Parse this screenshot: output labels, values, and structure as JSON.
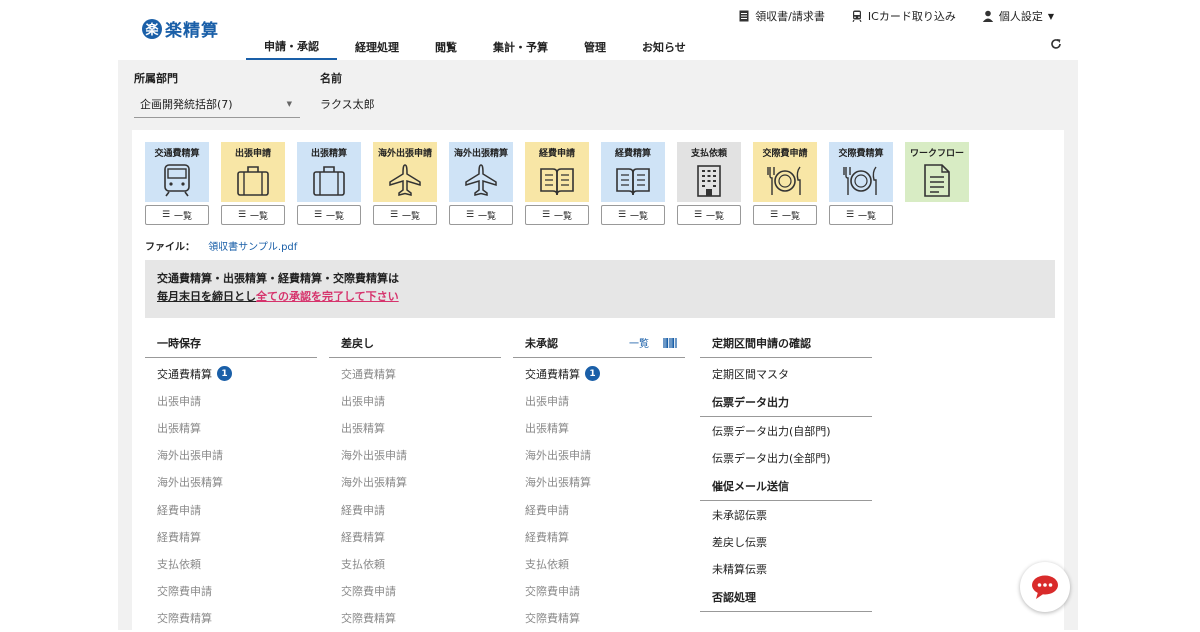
{
  "header": {
    "logo_mark": "楽",
    "logo_text": "楽精算",
    "util": [
      {
        "label": "領収書/請求書",
        "icon": "receipt-icon"
      },
      {
        "label": "ICカード取り込み",
        "icon": "train-icon"
      },
      {
        "label": "個人設定",
        "icon": "user-icon"
      }
    ],
    "tabs": [
      "申請・承認",
      "経理処理",
      "閲覧",
      "集計・予算",
      "管理",
      "お知らせ"
    ],
    "active_tab": "申請・承認"
  },
  "filter": {
    "dept_label": "所属部門",
    "dept_value": "企画開発統括部(7)",
    "name_label": "名前",
    "name_value": "ラクス太郎"
  },
  "tiles": [
    {
      "label": "交通費精算",
      "color": "blue",
      "icon": "train-icon",
      "btn": "一覧"
    },
    {
      "label": "出張申請",
      "color": "yellow",
      "icon": "suitcase-icon",
      "btn": "一覧"
    },
    {
      "label": "出張精算",
      "color": "blue",
      "icon": "suitcase-icon",
      "btn": "一覧"
    },
    {
      "label": "海外出張申請",
      "color": "yellow",
      "icon": "airplane-icon",
      "btn": "一覧"
    },
    {
      "label": "海外出張精算",
      "color": "blue",
      "icon": "airplane-icon",
      "btn": "一覧"
    },
    {
      "label": "経費申請",
      "color": "yellow",
      "icon": "book-icon",
      "btn": "一覧"
    },
    {
      "label": "経費精算",
      "color": "blue",
      "icon": "book-icon",
      "btn": "一覧"
    },
    {
      "label": "支払依頼",
      "color": "gray",
      "icon": "building-icon",
      "btn": "一覧"
    },
    {
      "label": "交際費申請",
      "color": "yellow",
      "icon": "dining-icon",
      "btn": "一覧"
    },
    {
      "label": "交際費精算",
      "color": "blue",
      "icon": "dining-icon",
      "btn": "一覧"
    },
    {
      "label": "ワークフロー",
      "color": "green",
      "icon": "document-icon",
      "btn": ""
    }
  ],
  "file": {
    "label": "ファイル：",
    "link": "領収書サンプル.pdf"
  },
  "notice": {
    "line1": "交通費精算・出張精算・経費精算・交際費精算は",
    "line2a": "毎月末日を締日とし",
    "line2b": "全ての承認を完了して下さい"
  },
  "columns": [
    {
      "title": "一時保存",
      "tools": false,
      "items": [
        {
          "label": "交通費精算",
          "badge": "1"
        },
        {
          "label": "出張申請",
          "badge": ""
        },
        {
          "label": "出張精算",
          "badge": ""
        },
        {
          "label": "海外出張申請",
          "badge": ""
        },
        {
          "label": "海外出張精算",
          "badge": ""
        },
        {
          "label": "経費申請",
          "badge": ""
        },
        {
          "label": "経費精算",
          "badge": ""
        },
        {
          "label": "支払依頼",
          "badge": ""
        },
        {
          "label": "交際費申請",
          "badge": ""
        },
        {
          "label": "交際費精算",
          "badge": ""
        }
      ]
    },
    {
      "title": "差戻し",
      "tools": false,
      "items": [
        {
          "label": "交通費精算",
          "badge": ""
        },
        {
          "label": "出張申請",
          "badge": ""
        },
        {
          "label": "出張精算",
          "badge": ""
        },
        {
          "label": "海外出張申請",
          "badge": ""
        },
        {
          "label": "海外出張精算",
          "badge": ""
        },
        {
          "label": "経費申請",
          "badge": ""
        },
        {
          "label": "経費精算",
          "badge": ""
        },
        {
          "label": "支払依頼",
          "badge": ""
        },
        {
          "label": "交際費申請",
          "badge": ""
        },
        {
          "label": "交際費精算",
          "badge": ""
        }
      ]
    },
    {
      "title": "未承認",
      "tools": true,
      "tool_label": "一覧",
      "items": [
        {
          "label": "交通費精算",
          "badge": "1"
        },
        {
          "label": "出張申請",
          "badge": ""
        },
        {
          "label": "出張精算",
          "badge": ""
        },
        {
          "label": "海外出張申請",
          "badge": ""
        },
        {
          "label": "海外出張精算",
          "badge": ""
        },
        {
          "label": "経費申請",
          "badge": ""
        },
        {
          "label": "経費精算",
          "badge": ""
        },
        {
          "label": "支払依頼",
          "badge": ""
        },
        {
          "label": "交際費申請",
          "badge": ""
        },
        {
          "label": "交際費精算",
          "badge": ""
        }
      ]
    }
  ],
  "side": {
    "title": "定期区間申請の確認",
    "sections": [
      {
        "head": "",
        "links": [
          "定期区間マスタ"
        ]
      },
      {
        "head": "伝票データ出力",
        "links": [
          "伝票データ出力(自部門)",
          "伝票データ出力(全部門)"
        ]
      },
      {
        "head": "催促メール送信",
        "links": [
          "未承認伝票",
          "差戻し伝票",
          "未精算伝票"
        ]
      },
      {
        "head": "否認処理",
        "links": []
      }
    ]
  }
}
